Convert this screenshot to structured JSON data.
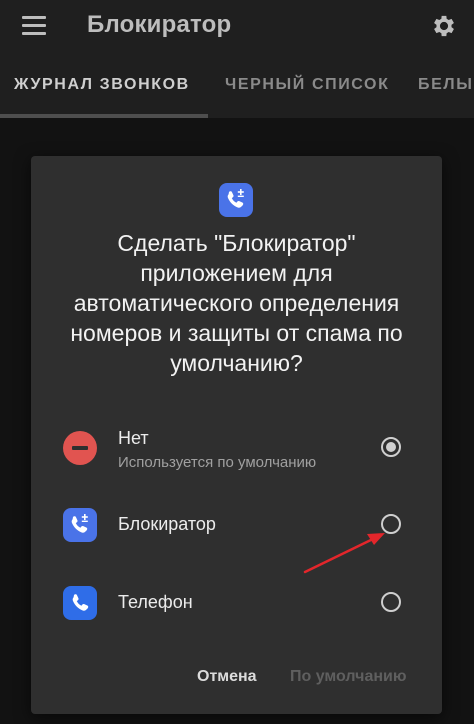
{
  "appbar": {
    "title": "Блокиратор"
  },
  "tabs": [
    {
      "label": "ЖУРНАЛ ЗВОНКОВ"
    },
    {
      "label": "ЧЕРНЫЙ СПИСОК"
    },
    {
      "label": "БЕЛЫЙ СПИСОК"
    }
  ],
  "dialog": {
    "title": "Сделать \"Блокиратор\" приложением для автоматического определения номеров и защиты от спама по умолчанию?",
    "options": [
      {
        "name": "Нет",
        "subtitle": "Используется по умолчанию",
        "selected": true
      },
      {
        "name": "Блокиратор",
        "selected": false
      },
      {
        "name": "Телефон",
        "selected": false
      }
    ],
    "buttons": {
      "cancel": "Отмена",
      "default": "По умолчанию"
    }
  },
  "colors": {
    "accent_blue": "#4a73e8",
    "no_red": "#e15450",
    "arrow_red": "#e3262b"
  }
}
